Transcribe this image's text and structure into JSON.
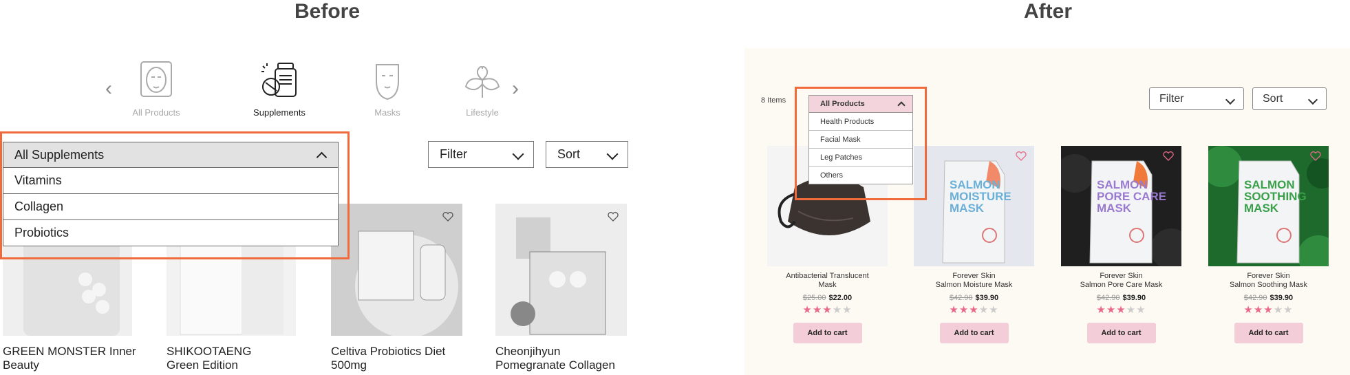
{
  "before": {
    "heading": "Before",
    "categories": [
      {
        "label": "All Products",
        "icon": "face-icon"
      },
      {
        "label": "Supplements",
        "icon": "supplements-icon"
      },
      {
        "label": "Masks",
        "icon": "mask-icon"
      },
      {
        "label": "Lifestyle",
        "icon": "leaf-heart-icon"
      }
    ],
    "dropdown": {
      "selected": "All Supplements",
      "options": [
        "Vitamins",
        "Collagen",
        "Probiotics"
      ]
    },
    "filter_label": "Filter",
    "sort_label": "Sort",
    "products": [
      {
        "name_line1": "GREEN MONSTER Inner",
        "name_line2": "Beauty"
      },
      {
        "name_line1": "SHIKOOTAENG",
        "name_line2": "Green Edition"
      },
      {
        "name_line1": "Celtiva Probiotics Diet",
        "name_line2": "500mg"
      },
      {
        "name_line1": "Cheonjihyun",
        "name_line2": "Pomegranate Collagen"
      }
    ]
  },
  "after": {
    "heading": "After",
    "items_count": "8 Items",
    "dropdown": {
      "selected": "All Products",
      "options": [
        "Health Products",
        "Facial Mask",
        "Leg Patches",
        "Others"
      ]
    },
    "filter_label": "Filter",
    "sort_label": "Sort",
    "products": [
      {
        "name_line1": "Antibacterial Translucent",
        "name_line2": "Mask",
        "old_price": "$25.00",
        "price": "$22.00",
        "rating": 3,
        "cart": "Add to cart"
      },
      {
        "name_line1": "Forever Skin",
        "name_line2": "Salmon Moisture Mask",
        "old_price": "$42.90",
        "price": "$39.90",
        "rating": 3,
        "cart": "Add to cart",
        "pack_text": [
          "SALMON",
          "MOISTURE",
          "MASK"
        ]
      },
      {
        "name_line1": "Forever Skin",
        "name_line2": "Salmon Pore Care Mask",
        "old_price": "$42.90",
        "price": "$39.90",
        "rating": 3,
        "cart": "Add to cart",
        "pack_text": [
          "SALMON",
          "PORE CARE",
          "MASK"
        ]
      },
      {
        "name_line1": "Forever Skin",
        "name_line2": "Salmon Soothing Mask",
        "old_price": "$42.90",
        "price": "$39.90",
        "rating": 3,
        "cart": "Add to cart",
        "pack_text": [
          "SALMON",
          "SOOTHING",
          "MASK"
        ]
      }
    ]
  },
  "colors": {
    "highlight": "#f06a3c",
    "accent_pink": "#f3cdd8",
    "star_on": "#e86a88",
    "after_bg": "#fdfaf3"
  }
}
